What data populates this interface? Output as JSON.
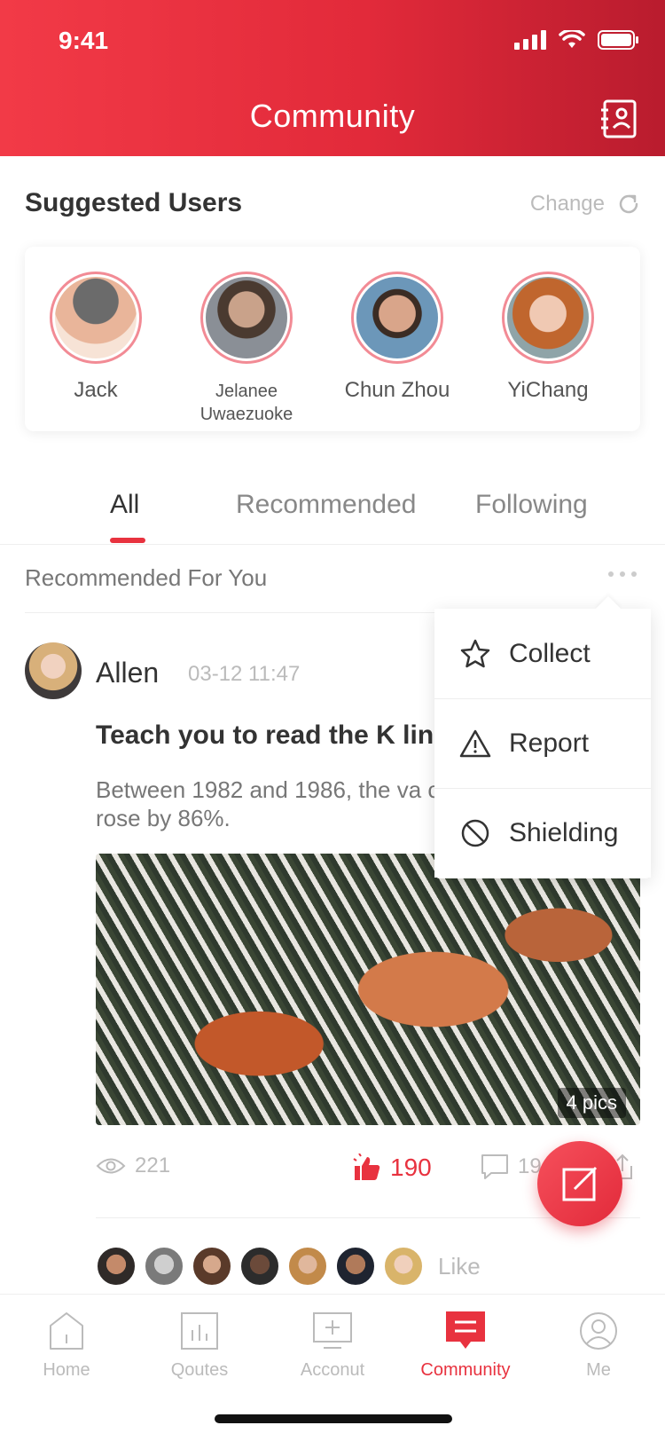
{
  "status_bar": {
    "time": "9:41"
  },
  "header": {
    "title": "Community",
    "contacts_icon": "contacts-book-icon"
  },
  "suggested": {
    "title": "Suggested Users",
    "change_label": "Change",
    "users": [
      {
        "name": "Jack"
      },
      {
        "name": "Jelanee Uwaezuoke"
      },
      {
        "name": "Chun Zhou"
      },
      {
        "name": "YiChang"
      }
    ]
  },
  "tabs": [
    {
      "label": "All",
      "active": true
    },
    {
      "label": "Recommended",
      "active": false
    },
    {
      "label": "Following",
      "active": false
    }
  ],
  "section": {
    "title": "Recommended For You"
  },
  "post": {
    "author": "Allen",
    "time": "03-12 11:47",
    "title": "Teach you to read the K lin",
    "body": "Between 1982 and 1986, the va company’s stock rose by 86%.",
    "pics_label": "4 pics",
    "views": "221",
    "likes": "190",
    "comments": "19",
    "like_label": "Like"
  },
  "menu": [
    {
      "label": "Collect",
      "icon": "star-icon"
    },
    {
      "label": "Report",
      "icon": "warning-icon"
    },
    {
      "label": "Shielding",
      "icon": "block-icon"
    }
  ],
  "tabbar": [
    {
      "label": "Home",
      "icon": "home-icon",
      "active": false
    },
    {
      "label": "Qoutes",
      "icon": "chart-icon",
      "active": false
    },
    {
      "label": "Acconut",
      "icon": "account-icon",
      "active": false
    },
    {
      "label": "Community",
      "icon": "community-icon",
      "active": true
    },
    {
      "label": "Me",
      "icon": "profile-icon",
      "active": false
    }
  ],
  "colors": {
    "primary": "#e8323f",
    "header_start": "#f23a47",
    "header_end": "#b91c2e"
  }
}
